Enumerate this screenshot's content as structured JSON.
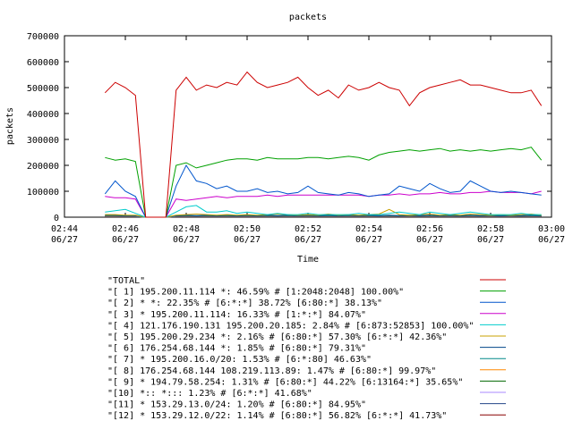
{
  "chart_data": {
    "type": "line",
    "title": "packets",
    "xlabel": "Time",
    "ylabel": "packets",
    "ylim": [
      0,
      700000
    ],
    "y_ticks": [
      0,
      100000,
      200000,
      300000,
      400000,
      500000,
      600000,
      700000
    ],
    "y_tick_labels": [
      "0",
      "100000",
      "200000",
      "300000",
      "400000",
      "500000",
      "600000",
      "700000"
    ],
    "xlim": [
      "02:44",
      "03:00"
    ],
    "x_ticks": [
      {
        "time": "02:44",
        "date": "06/27"
      },
      {
        "time": "02:46",
        "date": "06/27"
      },
      {
        "time": "02:48",
        "date": "06/27"
      },
      {
        "time": "02:50",
        "date": "06/27"
      },
      {
        "time": "02:52",
        "date": "06/27"
      },
      {
        "time": "02:54",
        "date": "06/27"
      },
      {
        "time": "02:56",
        "date": "06/27"
      },
      {
        "time": "02:58",
        "date": "06/27"
      },
      {
        "time": "03:00",
        "date": "06/27"
      }
    ],
    "grid": false,
    "legend_position": "bottom",
    "x": [
      "02:45:20",
      "02:45:40",
      "02:46:00",
      "02:46:20",
      "02:46:40",
      "02:47:00",
      "02:47:20",
      "02:47:40",
      "02:48:00",
      "02:48:20",
      "02:48:40",
      "02:49:00",
      "02:49:20",
      "02:49:40",
      "02:50:00",
      "02:50:20",
      "02:50:40",
      "02:51:00",
      "02:51:20",
      "02:51:40",
      "02:52:00",
      "02:52:20",
      "02:52:40",
      "02:53:00",
      "02:53:20",
      "02:53:40",
      "02:54:00",
      "02:54:20",
      "02:54:40",
      "02:55:00",
      "02:55:20",
      "02:55:40",
      "02:56:00",
      "02:56:20",
      "02:56:40",
      "02:57:00",
      "02:57:20",
      "02:57:40",
      "02:58:00",
      "02:58:20",
      "02:58:40",
      "02:59:00",
      "02:59:20",
      "02:59:40"
    ],
    "series": [
      {
        "name": "\"TOTAL\"",
        "color": "#cc0000",
        "values": [
          480000,
          520000,
          500000,
          470000,
          0,
          0,
          0,
          490000,
          540000,
          490000,
          510000,
          500000,
          520000,
          510000,
          560000,
          520000,
          500000,
          510000,
          520000,
          540000,
          500000,
          470000,
          490000,
          460000,
          510000,
          490000,
          500000,
          520000,
          500000,
          490000,
          430000,
          480000,
          500000,
          510000,
          520000,
          530000,
          510000,
          510000,
          500000,
          490000,
          480000,
          480000,
          490000,
          430000
        ]
      },
      {
        "name": "\"[ 1] 195.200.11.114 *: 46.59% # [1:2048:2048] 100.00%\"",
        "color": "#00a000",
        "values": [
          230000,
          220000,
          225000,
          215000,
          0,
          0,
          0,
          200000,
          210000,
          190000,
          200000,
          210000,
          220000,
          225000,
          225000,
          220000,
          230000,
          225000,
          225000,
          225000,
          230000,
          230000,
          225000,
          230000,
          235000,
          230000,
          220000,
          240000,
          250000,
          255000,
          260000,
          255000,
          260000,
          265000,
          255000,
          260000,
          255000,
          260000,
          255000,
          260000,
          265000,
          260000,
          270000,
          220000
        ]
      },
      {
        "name": "\"[ 2] * *: 22.35% # [6:*:*] 38.72% [6:80:*] 38.13%\"",
        "color": "#0055cc",
        "values": [
          90000,
          140000,
          100000,
          80000,
          0,
          0,
          0,
          120000,
          200000,
          140000,
          130000,
          110000,
          120000,
          100000,
          100000,
          110000,
          95000,
          100000,
          90000,
          95000,
          120000,
          95000,
          90000,
          85000,
          95000,
          90000,
          80000,
          85000,
          90000,
          120000,
          110000,
          100000,
          130000,
          110000,
          95000,
          100000,
          140000,
          120000,
          100000,
          95000,
          100000,
          95000,
          90000,
          85000
        ]
      },
      {
        "name": "\"[ 3] * 195.200.11.114: 16.33% # [1:*:*] 84.07%\"",
        "color": "#cc00cc",
        "values": [
          80000,
          75000,
          75000,
          70000,
          0,
          0,
          0,
          70000,
          65000,
          70000,
          75000,
          80000,
          75000,
          80000,
          80000,
          80000,
          85000,
          80000,
          85000,
          85000,
          85000,
          85000,
          85000,
          85000,
          85000,
          85000,
          80000,
          85000,
          85000,
          90000,
          85000,
          90000,
          90000,
          95000,
          90000,
          90000,
          95000,
          95000,
          100000,
          95000,
          95000,
          95000,
          90000,
          100000
        ]
      },
      {
        "name": "\"[ 4] 121.176.190.131 195.200.20.185: 2.84% # [6:873:52853] 100.00%\"",
        "color": "#00cccc",
        "values": [
          20000,
          25000,
          30000,
          15000,
          0,
          0,
          0,
          20000,
          40000,
          45000,
          20000,
          20000,
          25000,
          15000,
          20000,
          15000,
          10000,
          15000,
          10000,
          10000,
          15000,
          10000,
          10000,
          10000,
          10000,
          15000,
          10000,
          10000,
          15000,
          20000,
          15000,
          10000,
          20000,
          15000,
          10000,
          15000,
          20000,
          15000,
          10000,
          10000,
          10000,
          15000,
          10000,
          10000
        ]
      },
      {
        "name": "\"[ 5] 195.200.29.234 *: 2.16% # [6:80:*] 57.30% [6:*:*] 42.36%\"",
        "color": "#c8a000",
        "values": [
          10000,
          10000,
          8000,
          8000,
          0,
          0,
          0,
          8000,
          10000,
          12000,
          10000,
          8000,
          10000,
          8000,
          10000,
          8000,
          10000,
          12000,
          10000,
          8000,
          10000,
          8000,
          12000,
          8000,
          10000,
          8000,
          10000,
          12000,
          30000,
          10000,
          8000,
          10000,
          12000,
          8000,
          10000,
          8000,
          12000,
          10000,
          8000,
          10000,
          8000,
          10000,
          12000,
          8000
        ]
      },
      {
        "name": "\"[ 6] 176.254.68.144 *: 1.85% # [6:80:*] 79.31%\"",
        "color": "#004488",
        "values": [
          8000,
          8000,
          6000,
          6000,
          0,
          0,
          0,
          6000,
          8000,
          6000,
          8000,
          6000,
          8000,
          6000,
          8000,
          6000,
          8000,
          6000,
          8000,
          6000,
          8000,
          6000,
          8000,
          6000,
          8000,
          6000,
          8000,
          6000,
          8000,
          6000,
          8000,
          6000,
          8000,
          6000,
          8000,
          6000,
          8000,
          6000,
          8000,
          6000,
          8000,
          6000,
          8000,
          6000
        ]
      },
      {
        "name": "\"[ 7] * 195.200.16.0/20: 1.53% # [6:*:80] 46.63%\"",
        "color": "#008888",
        "values": [
          6000,
          6000,
          5000,
          5000,
          0,
          0,
          0,
          5000,
          6000,
          5000,
          6000,
          5000,
          6000,
          5000,
          6000,
          5000,
          6000,
          5000,
          6000,
          5000,
          6000,
          5000,
          6000,
          5000,
          6000,
          5000,
          6000,
          5000,
          6000,
          5000,
          6000,
          5000,
          6000,
          5000,
          6000,
          5000,
          6000,
          5000,
          6000,
          5000,
          6000,
          5000,
          6000,
          5000
        ]
      },
      {
        "name": "\"[ 8] 176.254.68.144 108.219.113.89: 1.47% # [6:80:*] 99.97%\"",
        "color": "#ff8800",
        "values": [
          5000,
          5000,
          5000,
          5000,
          0,
          0,
          0,
          5000,
          5000,
          5000,
          5000,
          5000,
          5000,
          5000,
          5000,
          5000,
          5000,
          5000,
          5000,
          5000,
          5000,
          5000,
          5000,
          5000,
          5000,
          5000,
          5000,
          5000,
          5000,
          5000,
          5000,
          5000,
          5000,
          5000,
          5000,
          5000,
          5000,
          5000,
          5000,
          5000,
          5000,
          5000,
          5000,
          5000
        ]
      },
      {
        "name": "\"[ 9] * 194.79.58.254: 1.31% # [6:80:*] 44.22% [6:13164:*] 35.65%\"",
        "color": "#006600",
        "values": [
          4000,
          4000,
          4000,
          4000,
          0,
          0,
          0,
          4000,
          4000,
          4000,
          4000,
          4000,
          4000,
          4000,
          4000,
          4000,
          4000,
          4000,
          4000,
          4000,
          4000,
          4000,
          4000,
          4000,
          4000,
          4000,
          4000,
          4000,
          4000,
          4000,
          4000,
          4000,
          4000,
          4000,
          4000,
          4000,
          4000,
          4000,
          4000,
          4000,
          4000,
          4000,
          4000,
          4000
        ]
      },
      {
        "name": "\"[10] *:: *::: 1.23% # [6:*:*] 41.68%\"",
        "color": "#aa88ff",
        "values": [
          3000,
          3000,
          3000,
          3000,
          0,
          0,
          0,
          3000,
          3000,
          3000,
          3000,
          3000,
          3000,
          3000,
          3000,
          3000,
          3000,
          3000,
          3000,
          3000,
          3000,
          3000,
          3000,
          3000,
          3000,
          3000,
          3000,
          3000,
          3000,
          3000,
          3000,
          3000,
          3000,
          3000,
          3000,
          3000,
          3000,
          3000,
          3000,
          3000,
          3000,
          3000,
          3000,
          3000
        ]
      },
      {
        "name": "\"[11] * 153.29.13.0/24: 1.20% # [6:80:*] 84.95%\"",
        "color": "#224488",
        "values": [
          3000,
          3000,
          3000,
          3000,
          0,
          0,
          0,
          3000,
          3000,
          3000,
          3000,
          3000,
          3000,
          3000,
          3000,
          3000,
          3000,
          3000,
          3000,
          3000,
          3000,
          3000,
          3000,
          3000,
          3000,
          3000,
          3000,
          3000,
          3000,
          3000,
          3000,
          3000,
          3000,
          3000,
          3000,
          3000,
          3000,
          3000,
          3000,
          3000,
          3000,
          3000,
          3000,
          3000
        ]
      },
      {
        "name": "\"[12] * 153.29.12.0/22: 1.14% # [6:80:*] 56.82% [6:*:*] 41.73%\"",
        "color": "#880000",
        "values": [
          2000,
          2000,
          2000,
          2000,
          0,
          0,
          0,
          2000,
          2000,
          2000,
          2000,
          2000,
          2000,
          2000,
          2000,
          2000,
          2000,
          2000,
          2000,
          2000,
          2000,
          2000,
          2000,
          2000,
          2000,
          2000,
          2000,
          2000,
          2000,
          2000,
          2000,
          2000,
          2000,
          2000,
          2000,
          2000,
          2000,
          2000,
          2000,
          2000,
          2000,
          2000,
          2000,
          2000
        ]
      }
    ]
  }
}
